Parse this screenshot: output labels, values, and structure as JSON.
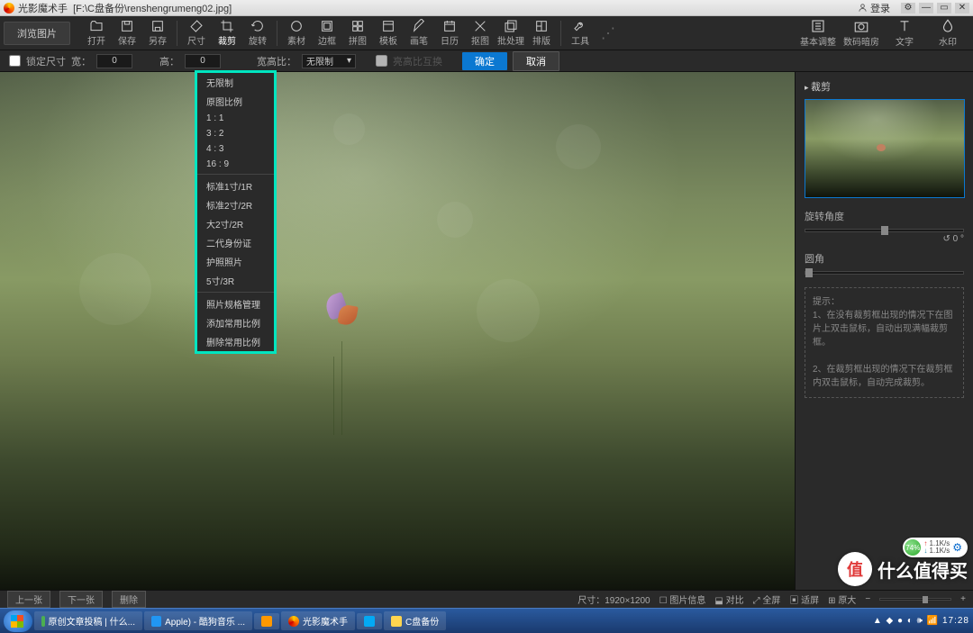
{
  "title": {
    "app": "光影魔术手",
    "file": "[F:\\C盘备份\\renshengrumeng02.jpg]"
  },
  "titlebar": {
    "login": "登录"
  },
  "toolbar": {
    "browse": "浏览图片",
    "tools": [
      "打开",
      "保存",
      "另存",
      "尺寸",
      "裁剪",
      "旋转",
      "素材",
      "边框",
      "拼图",
      "模板",
      "画笔",
      "日历",
      "抠图",
      "批处理",
      "排版",
      "工具"
    ],
    "active_index": 4,
    "rtools": [
      "基本调整",
      "数码暗房",
      "文字",
      "水印"
    ]
  },
  "subbar": {
    "lock_size": "锁定尺寸",
    "width_lbl": "宽：",
    "width_val": "0",
    "height_lbl": "高：",
    "height_val": "0",
    "ratio_lbl": "宽高比：",
    "ratio_val": "无限制",
    "swap": "亮高比互换",
    "ok": "确定",
    "cancel": "取消"
  },
  "dropdown": {
    "group1": [
      "无限制",
      "原图比例",
      "1 : 1",
      "3 : 2",
      "4 : 3",
      "16 : 9"
    ],
    "group2": [
      "标准1寸/1R",
      "标准2寸/2R",
      "大2寸/2R",
      "二代身份证",
      "护照照片",
      "5寸/3R"
    ],
    "group3": [
      "照片规格管理",
      "添加常用比例",
      "删除常用比例"
    ]
  },
  "rightpanel": {
    "heading": "裁剪",
    "rotate_lbl": "旋转角度",
    "rotate_val": "0 °",
    "round_lbl": "圆角",
    "hint_title": "提示：",
    "hint1": "1、在没有裁剪框出现的情况下在图片上双击鼠标，自动出现满幅裁剪框。",
    "hint2": "2、在裁剪框出现的情况下在裁剪框内双击鼠标，自动完成裁剪。"
  },
  "bottombar": {
    "prev": "上一张",
    "next": "下一张",
    "del": "删除",
    "size": "尺寸：1920×1200",
    "info": "图片信息",
    "compare": "对比",
    "full": "全屏",
    "fit": "适屏",
    "orig": "原大"
  },
  "taskbar": {
    "tasks": [
      "原创文章投稿 | 什么...",
      "Apple) - 酷狗音乐 ...",
      "",
      "光影魔术手",
      "",
      "C盘备份"
    ],
    "clock": "17:28"
  },
  "watermark": {
    "char": "值",
    "text": "什么值得买"
  },
  "net": {
    "pct": "74%",
    "up": "1.1K/s",
    "dn": "1.1K/s"
  },
  "icons": {
    "open": "folder-open-icon",
    "save": "save-icon",
    "saveas": "saveas-icon",
    "size": "ruler-icon",
    "crop": "crop-icon",
    "rotate": "rotate-icon",
    "material": "material-icon",
    "frame": "frame-icon",
    "collage": "collage-icon",
    "template": "template-icon",
    "brush": "brush-icon",
    "calendar": "calendar-icon",
    "cutout": "cutout-icon",
    "batch": "batch-icon",
    "layout": "layout-icon",
    "tools": "tools-icon",
    "basic": "sliders-icon",
    "darkroom": "camera-icon",
    "text": "text-icon",
    "watermark": "droplet-icon"
  }
}
